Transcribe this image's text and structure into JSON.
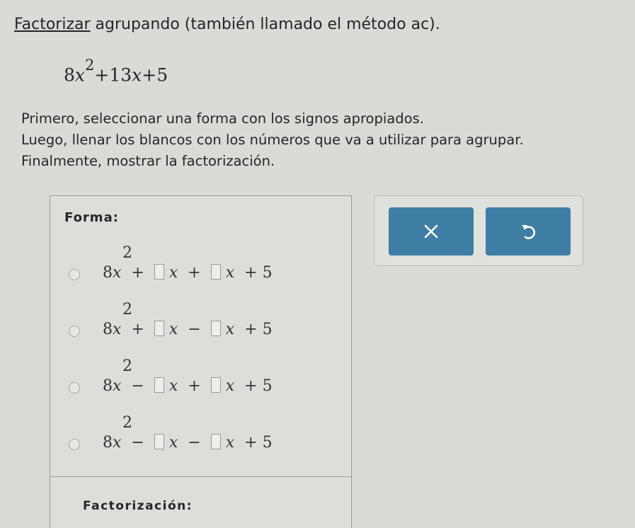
{
  "problem": {
    "title_keyword": "Factorizar",
    "title_rest": " agrupando (también llamado el método ac).",
    "expression": {
      "coef": "8",
      "var": "x",
      "exp": "2",
      "rest_1": "+13",
      "rest_var": "x",
      "rest_2": "+5"
    },
    "instructions": [
      "Primero, seleccionar una forma con los signos apropiados.",
      "Luego, llenar los blancos con los números que va a utilizar para agrupar.",
      "Finalmente, mostrar la factorización."
    ]
  },
  "form_panel": {
    "label": "Forma:",
    "leading_term": "8",
    "variable": "x",
    "exponent": "2",
    "constant": "+ 5",
    "options": [
      {
        "sign1": "+",
        "sign2": "+"
      },
      {
        "sign1": "+",
        "sign2": "−"
      },
      {
        "sign1": "−",
        "sign2": "+"
      },
      {
        "sign1": "−",
        "sign2": "−"
      }
    ],
    "factorization_label": "Factorización:"
  },
  "toolbar": {
    "clear_icon": "x-icon",
    "undo_icon": "undo-arrow-icon",
    "accent_color": "#3f7ea5"
  }
}
